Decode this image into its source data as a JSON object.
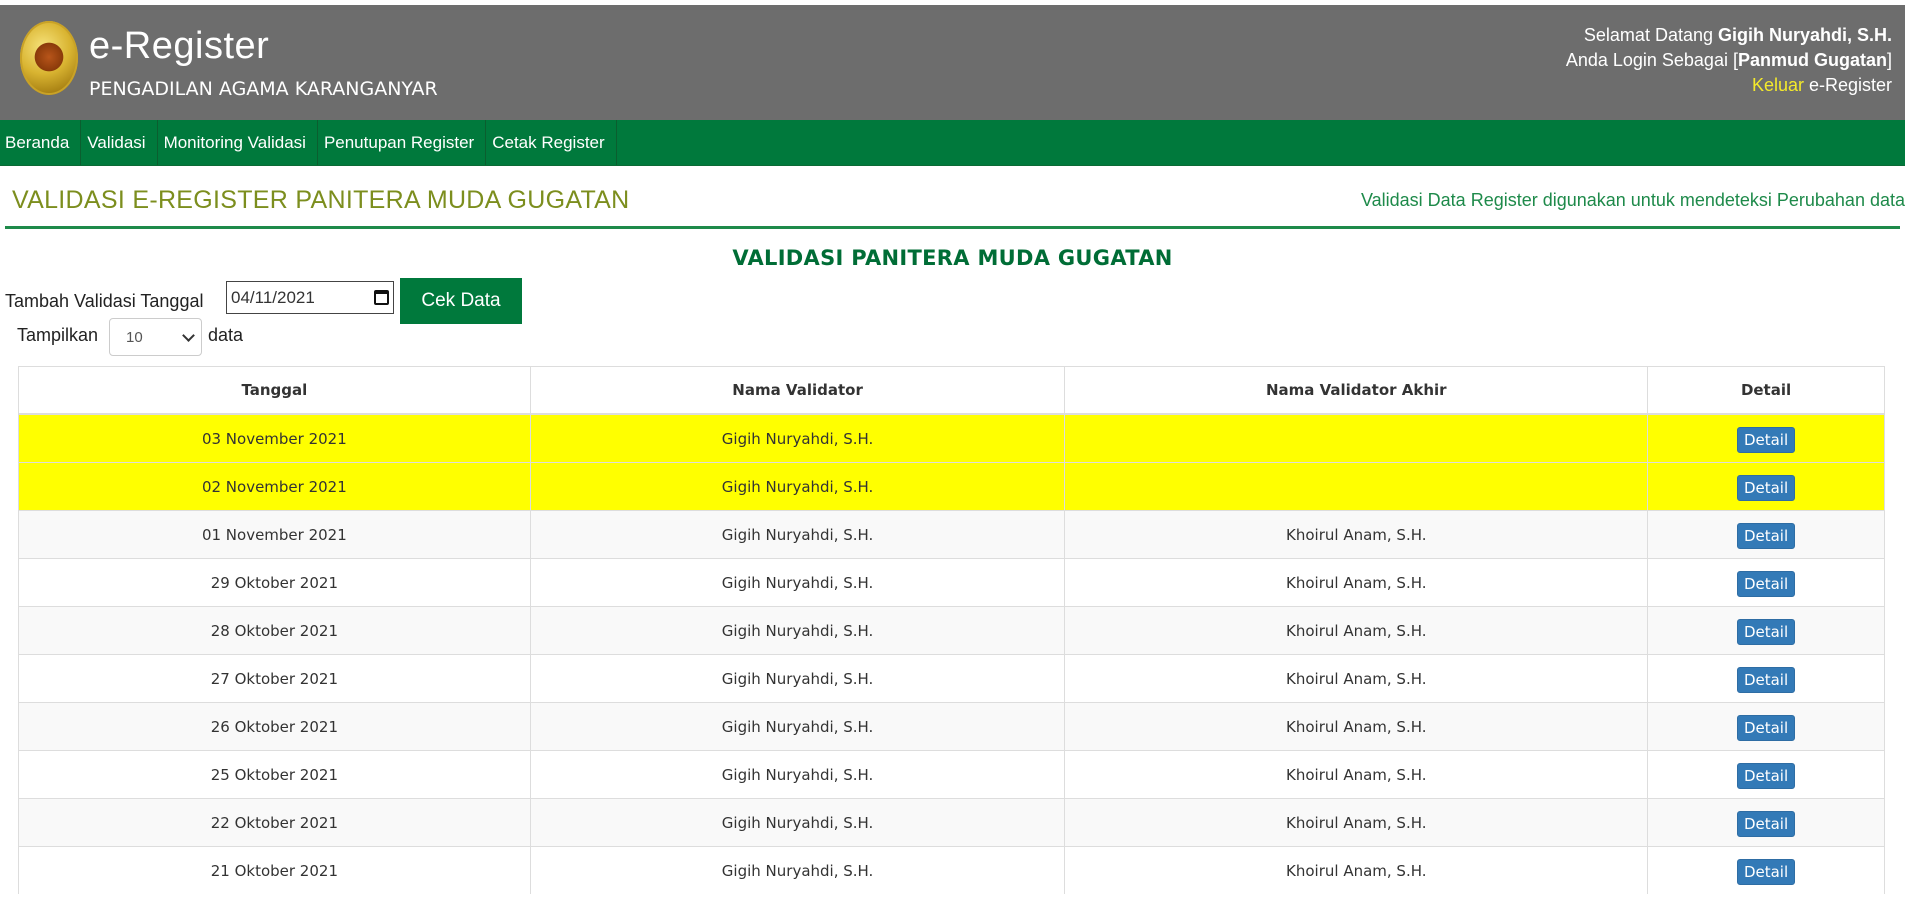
{
  "app": {
    "title": "e-Register",
    "court_name": "PENGADILAN AGAMA KARANGANYAR"
  },
  "user": {
    "greeting_prefix": "Selamat Datang ",
    "name": "Gigih Nuryahdi, S.H.",
    "login_prefix": "Anda Login Sebagai [",
    "role": "Panmud Gugatan",
    "login_suffix": "]",
    "logout_label": "Keluar",
    "logout_suffix": " e-Register"
  },
  "nav": {
    "items": [
      "Beranda",
      "Validasi",
      "Monitoring Validasi",
      "Penutupan Register",
      "Cetak Register"
    ]
  },
  "page": {
    "title": "VALIDASI E-REGISTER PANITERA MUDA GUGATAN",
    "subtitle": "Validasi Data Register digunakan untuk mendeteksi Perubahan data",
    "section_title": "VALIDASI PANITERA MUDA GUGATAN"
  },
  "form": {
    "add_label": "Tambah Validasi Tanggal",
    "date_value": "04/11/2021",
    "check_button": "Cek Data",
    "show_label": "Tampilkan",
    "page_size": "10",
    "data_label": "data"
  },
  "table": {
    "headers": [
      "Tanggal",
      "Nama Validator",
      "Nama Validator Akhir",
      "Detail"
    ],
    "detail_label": "Detail",
    "rows": [
      {
        "date": "03 November 2021",
        "validator": "Gigih Nuryahdi, S.H.",
        "final_validator": "",
        "highlight": true
      },
      {
        "date": "02 November 2021",
        "validator": "Gigih Nuryahdi, S.H.",
        "final_validator": "",
        "highlight": true
      },
      {
        "date": "01 November 2021",
        "validator": "Gigih Nuryahdi, S.H.",
        "final_validator": "Khoirul Anam, S.H.",
        "highlight": false
      },
      {
        "date": "29 Oktober 2021",
        "validator": "Gigih Nuryahdi, S.H.",
        "final_validator": "Khoirul Anam, S.H.",
        "highlight": false
      },
      {
        "date": "28 Oktober 2021",
        "validator": "Gigih Nuryahdi, S.H.",
        "final_validator": "Khoirul Anam, S.H.",
        "highlight": false
      },
      {
        "date": "27 Oktober 2021",
        "validator": "Gigih Nuryahdi, S.H.",
        "final_validator": "Khoirul Anam, S.H.",
        "highlight": false
      },
      {
        "date": "26 Oktober 2021",
        "validator": "Gigih Nuryahdi, S.H.",
        "final_validator": "Khoirul Anam, S.H.",
        "highlight": false
      },
      {
        "date": "25 Oktober 2021",
        "validator": "Gigih Nuryahdi, S.H.",
        "final_validator": "Khoirul Anam, S.H.",
        "highlight": false
      },
      {
        "date": "22 Oktober 2021",
        "validator": "Gigih Nuryahdi, S.H.",
        "final_validator": "Khoirul Anam, S.H.",
        "highlight": false
      },
      {
        "date": "21 Oktober 2021",
        "validator": "Gigih Nuryahdi, S.H.",
        "final_validator": "Khoirul Anam, S.H.",
        "highlight": false
      }
    ]
  },
  "colors": {
    "header_bg": "#6d6d6d",
    "nav_bg": "#00793c",
    "highlight_row": "#ffff00",
    "detail_button": "#337ab7",
    "logout_link": "#f4ea2b"
  }
}
